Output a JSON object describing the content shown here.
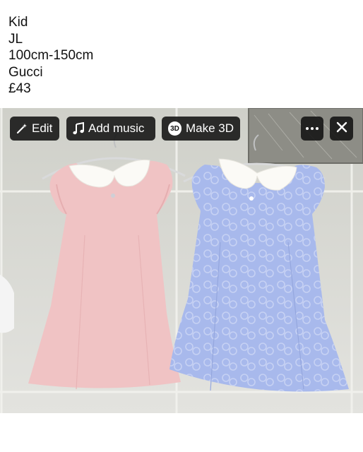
{
  "caption": [
    "Kid",
    "JL",
    "100cm-150cm",
    "Gucci",
    "£43"
  ],
  "toolbar": {
    "edit_label": "Edit",
    "music_label": "Add music",
    "make3d_label": "Make 3D",
    "badge_3d": "3D",
    "icons": {
      "edit": "magic-wand-icon",
      "music": "music-note-icon",
      "more": "more-horizontal-icon",
      "close": "close-icon"
    }
  },
  "colors": {
    "pink_dress": "#f0c4c4",
    "blue_dress": "#a8b9ec",
    "collar": "#fbfaf6",
    "toolbar_bg": "#121212"
  }
}
